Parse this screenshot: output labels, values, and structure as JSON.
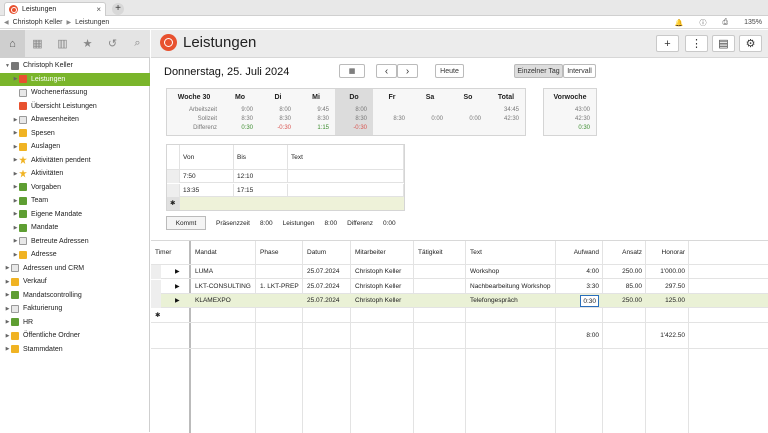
{
  "window": {
    "tab_title": "Leistungen",
    "tab_close": "×",
    "new_tab": "+",
    "zoom": "135%"
  },
  "breadcrumb": [
    "Christoph Keller",
    "Leistungen"
  ],
  "tree": [
    {
      "label": "Christoph Keller",
      "level": 0,
      "arrow": "▼",
      "icon": "gray"
    },
    {
      "label": "Leistungen",
      "level": 1,
      "arrow": "▶",
      "icon": "redc",
      "selected": true
    },
    {
      "label": "Wochenerfassung",
      "level": 1,
      "arrow": "",
      "icon": "doc"
    },
    {
      "label": "Übersicht Leistungen",
      "level": 1,
      "arrow": "",
      "icon": "redc"
    },
    {
      "label": "Abwesenheiten",
      "level": 1,
      "arrow": "▶",
      "icon": "doc"
    },
    {
      "label": "Spesen",
      "level": 1,
      "arrow": "▶",
      "icon": "folder"
    },
    {
      "label": "Auslagen",
      "level": 1,
      "arrow": "▶",
      "icon": "folder"
    },
    {
      "label": "Aktivitäten pendent",
      "level": 1,
      "arrow": "▶",
      "icon": "star"
    },
    {
      "label": "Aktivitäten",
      "level": 1,
      "arrow": "▶",
      "icon": "star"
    },
    {
      "label": "Vorgaben",
      "level": 1,
      "arrow": "▶",
      "icon": "green"
    },
    {
      "label": "Team",
      "level": 1,
      "arrow": "▶",
      "icon": "green"
    },
    {
      "label": "Eigene Mandate",
      "level": 1,
      "arrow": "▶",
      "icon": "green"
    },
    {
      "label": "Mandate",
      "level": 1,
      "arrow": "▶",
      "icon": "green"
    },
    {
      "label": "Betreute Adressen",
      "level": 1,
      "arrow": "▶",
      "icon": "doc"
    },
    {
      "label": "Adresse",
      "level": 1,
      "arrow": "▶",
      "icon": "folder"
    },
    {
      "label": "Adressen und CRM",
      "level": 0,
      "arrow": "▶",
      "icon": "doc"
    },
    {
      "label": "Verkauf",
      "level": 0,
      "arrow": "▶",
      "icon": "folder"
    },
    {
      "label": "Mandatscontrolling",
      "level": 0,
      "arrow": "▶",
      "icon": "green"
    },
    {
      "label": "Fakturierung",
      "level": 0,
      "arrow": "▶",
      "icon": "doc"
    },
    {
      "label": "HR",
      "level": 0,
      "arrow": "▶",
      "icon": "green"
    },
    {
      "label": "Öffentliche Ordner",
      "level": 0,
      "arrow": "▶",
      "icon": "folder"
    },
    {
      "label": "Stammdaten",
      "level": 0,
      "arrow": "▶",
      "icon": "folder"
    }
  ],
  "header": {
    "title": "Leistungen"
  },
  "day_title": "Donnerstag, 25. Juli 2024",
  "buttons": {
    "prev": "‹",
    "next": "›",
    "today": "Heute",
    "single_day": "Einzelner Tag",
    "interval": "Intervall",
    "add": "+",
    "menu": "⋮"
  },
  "week": {
    "row_labels": [
      "Arbeitszeit",
      "Sollzeit",
      "Differenz"
    ],
    "columns": [
      {
        "head": "Woche 30",
        "vals": [
          "",
          "",
          ""
        ]
      },
      {
        "head": "Mo",
        "vals": [
          "9:00",
          "8:30",
          "0:30"
        ]
      },
      {
        "head": "Di",
        "vals": [
          "8:00",
          "8:30",
          "-0:30"
        ]
      },
      {
        "head": "Mi",
        "vals": [
          "9:45",
          "8:30",
          "1:15"
        ]
      },
      {
        "head": "Do",
        "vals": [
          "8:00",
          "8:30",
          "-0:30"
        ]
      },
      {
        "head": "Fr",
        "vals": [
          "",
          "8:30",
          ""
        ]
      },
      {
        "head": "Sa",
        "vals": [
          "",
          "0:00",
          ""
        ]
      },
      {
        "head": "So",
        "vals": [
          "",
          "0:00",
          ""
        ]
      },
      {
        "head": "Total",
        "vals": [
          "34:45",
          "42:30",
          ""
        ]
      }
    ],
    "vorwoche": {
      "head": "Vorwoche",
      "vals": [
        "43:00",
        "42:30",
        "0:30"
      ]
    }
  },
  "times": {
    "headers": [
      "Von",
      "Bis",
      "Text"
    ],
    "rows": [
      [
        "7:50",
        "12:10",
        ""
      ],
      [
        "13:35",
        "17:15",
        ""
      ]
    ],
    "new_marker": "✱"
  },
  "presence": {
    "kommt": "Kommt",
    "praesenz_label": "Präsenzzeit",
    "praesenz": "8:00",
    "leistungen_label": "Leistungen",
    "leistungen": "8:00",
    "differenz_label": "Differenz",
    "differenz": "0:00"
  },
  "grid": {
    "headers": [
      "Timer",
      "Mandat",
      "Phase",
      "Datum",
      "Mitarbeiter",
      "Tätigkeit",
      "Text",
      "Aufwand",
      "Ansatz",
      "Honorar"
    ],
    "rows": [
      {
        "mandat": "LUMA",
        "phase": "",
        "datum": "25.07.2024",
        "mitarbeiter": "Christoph Keller",
        "taetigkeit": "",
        "text": "Workshop",
        "aufwand": "4:00",
        "ansatz": "250.00",
        "honorar": "1'000.00"
      },
      {
        "mandat": "LKT-CONSULTING",
        "phase": "1. LKT-PREP",
        "datum": "25.07.2024",
        "mitarbeiter": "Christoph Keller",
        "taetigkeit": "",
        "text": "Nachbearbeitung Workshop",
        "aufwand": "3:30",
        "ansatz": "85.00",
        "honorar": "297.50"
      },
      {
        "mandat": "KLAMEXPO",
        "phase": "",
        "datum": "25.07.2024",
        "mitarbeiter": "Christoph Keller",
        "taetigkeit": "",
        "text": "Telefongespräch",
        "aufwand": "0:30",
        "ansatz": "250.00",
        "honorar": "125.00"
      }
    ],
    "totals": {
      "aufwand": "8:00",
      "honorar": "1'422.50"
    },
    "play": "▶"
  },
  "colors": {
    "accent": "#7ab52b",
    "negative": "#d9534f",
    "positive": "#3c8d2f",
    "brand": "#e8512f"
  }
}
